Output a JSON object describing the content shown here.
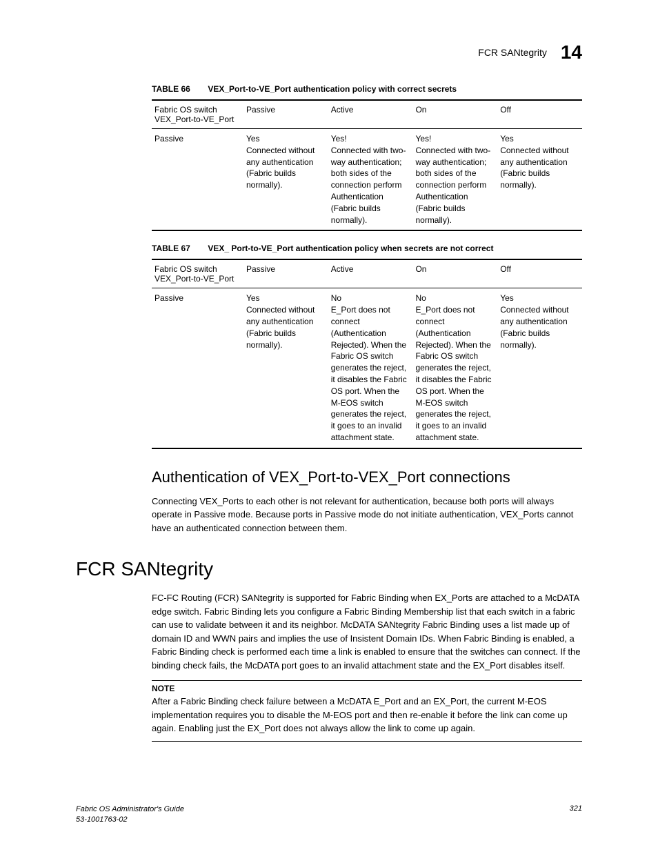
{
  "header": {
    "title": "FCR SANtegrity",
    "chapter": "14"
  },
  "table66": {
    "number": "TABLE 66",
    "title": "VEX_Port-to-VE_Port authentication policy with correct secrets",
    "headers": [
      "Fabric OS switch VEX_Port-to-VE_Port",
      "Passive",
      "Active",
      "On",
      "Off"
    ],
    "row": {
      "c0": "Passive",
      "c1": "Yes\nConnected without any authentication (Fabric builds normally).",
      "c2": "Yes!\nConnected with two-way authentication; both sides of the connection perform Authentication (Fabric builds normally).",
      "c3": "Yes!\nConnected with two-way authentication; both sides of the connection perform Authentication (Fabric builds normally).",
      "c4": "Yes\nConnected without any authentication (Fabric builds normally)."
    }
  },
  "table67": {
    "number": "TABLE 67",
    "title": "VEX_ Port-to-VE_Port authentication policy when secrets are not correct",
    "headers": [
      "Fabric OS switch VEX_Port-to-VE_Port",
      "Passive",
      "Active",
      "On",
      "Off"
    ],
    "row": {
      "c0": "Passive",
      "c1": "Yes\nConnected without any authentication (Fabric builds normally).",
      "c2": "No\nE_Port does not connect (Authentication Rejected). When the Fabric OS switch generates the reject, it disables the Fabric OS port. When the M-EOS switch generates the reject, it goes to an invalid attachment state.",
      "c3": "No\nE_Port does not connect (Authentication Rejected). When the Fabric OS switch generates the reject, it disables the Fabric OS port. When the M-EOS switch generates the reject, it goes to an invalid attachment state.",
      "c4": "Yes\nConnected without any authentication (Fabric builds normally)."
    }
  },
  "section2": {
    "heading": "Authentication of VEX_Port-to-VEX_Port connections",
    "para": "Connecting VEX_Ports to each other is not relevant for authentication, because both ports will always operate in Passive mode. Because ports in Passive mode do not initiate authentication, VEX_Ports cannot have an authenticated connection between them."
  },
  "section1": {
    "heading": "FCR SANtegrity",
    "para": "FC-FC Routing (FCR) SANtegrity is supported for Fabric Binding when EX_Ports are attached to a McDATA edge switch. Fabric Binding lets you configure a Fabric Binding Membership list that each switch in a fabric can use to validate between it and its neighbor. McDATA SANtegrity Fabric Binding uses a list made up of domain ID and WWN pairs and implies the use of Insistent Domain IDs. When Fabric Binding is enabled, a Fabric Binding check is performed each time a link is enabled to ensure that the switches can connect. If the binding check fails, the McDATA port goes to an invalid attachment state and the EX_Port disables itself."
  },
  "note": {
    "label": "NOTE",
    "text": "After a Fabric Binding check failure between a McDATA E_Port and an EX_Port, the current M-EOS implementation requires you to disable the M-EOS port and then re-enable it before the link can come up again. Enabling just the EX_Port does not always allow the link to come up again."
  },
  "footer": {
    "line1": "Fabric OS Administrator's Guide",
    "line2": "53-1001763-02",
    "page": "321"
  }
}
